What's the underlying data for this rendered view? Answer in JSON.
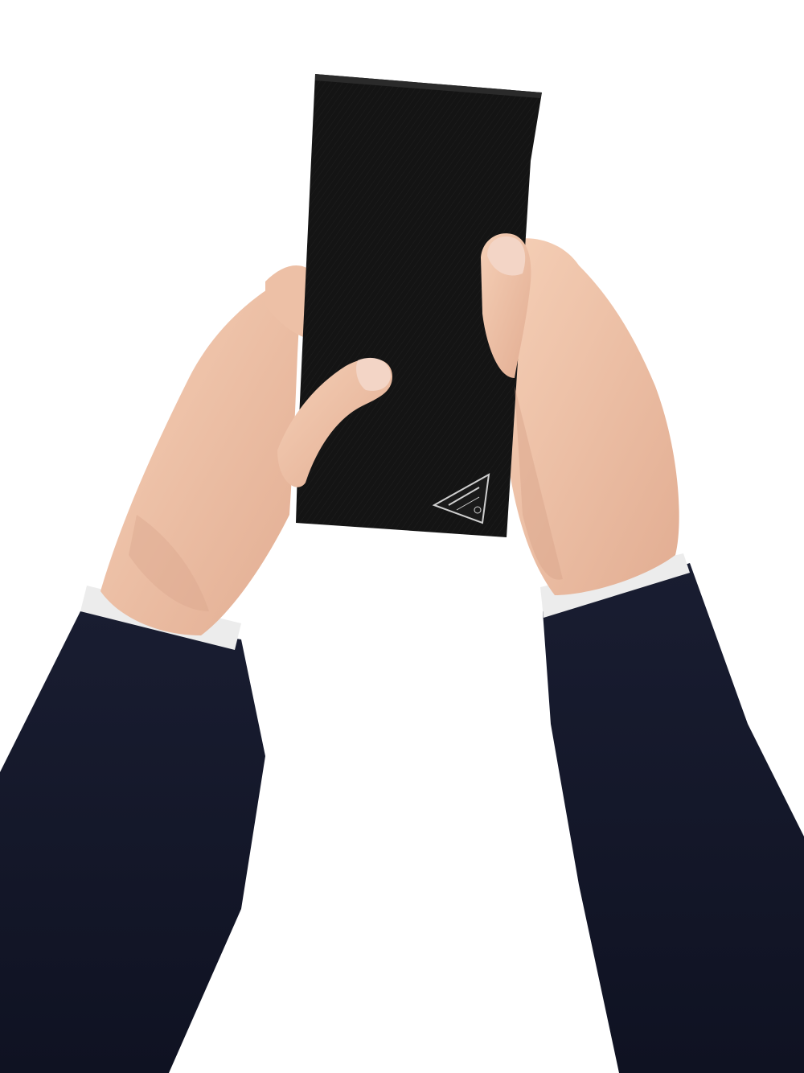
{
  "photo": {
    "subject": "hands-holding-wallet",
    "colors": {
      "background": "#ffffff",
      "wallet": "#141414",
      "sleeve": "#14172a",
      "cuff": "#e9e9e9",
      "skin": "#f1c7ad",
      "skin_shadow": "#d9a68c",
      "nail": "#f3d5c6",
      "plaque": "#1a1a1a",
      "plaque_trim": "#cfcfcf"
    }
  }
}
